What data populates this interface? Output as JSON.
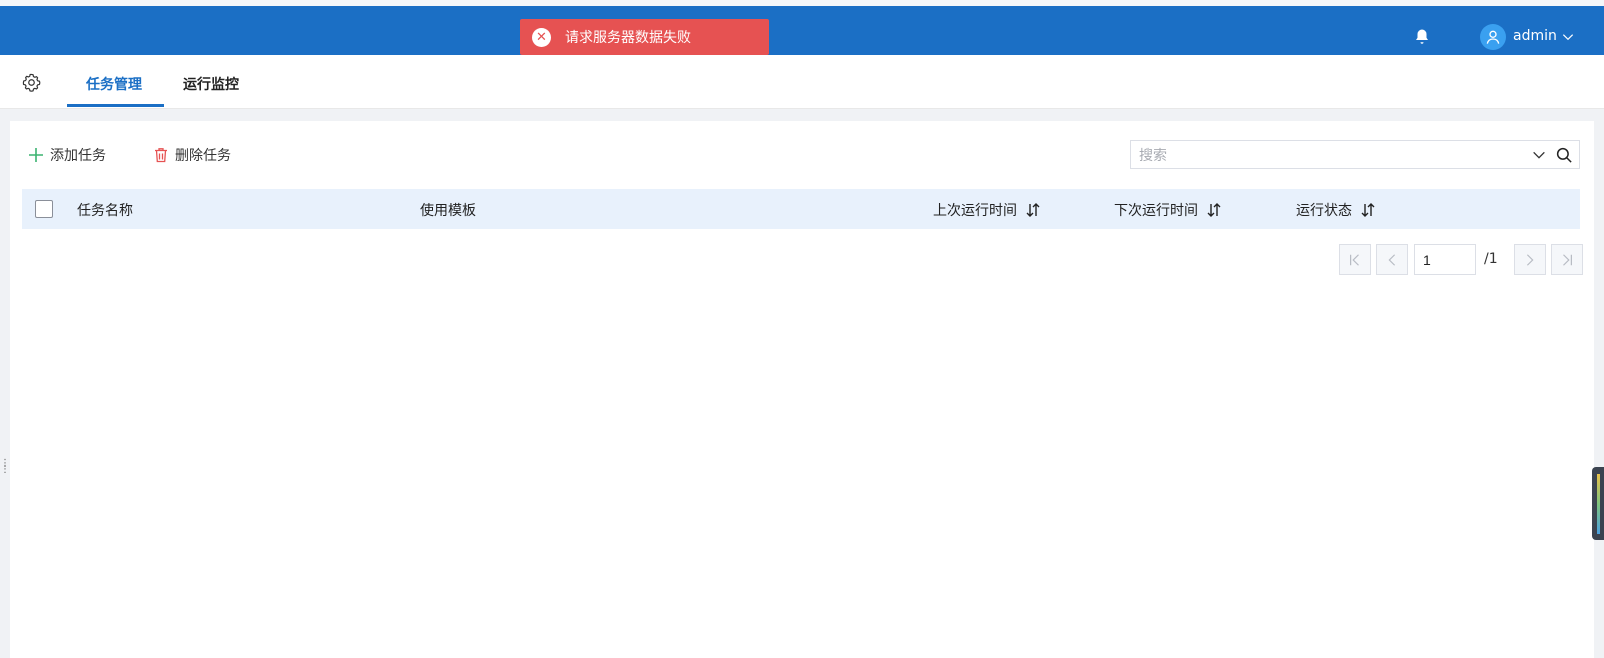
{
  "toast": {
    "message": "请求服务器数据失败",
    "icon": "close-circle-icon"
  },
  "user": {
    "name": "admin"
  },
  "tabs": [
    {
      "label": "任务管理",
      "active": true
    },
    {
      "label": "运行监控",
      "active": false
    }
  ],
  "toolbar": {
    "add_label": "添加任务",
    "delete_label": "删除任务"
  },
  "search": {
    "placeholder": "搜索",
    "value": ""
  },
  "table": {
    "columns": [
      {
        "label": "任务名称",
        "sortable": false
      },
      {
        "label": "使用模板",
        "sortable": false
      },
      {
        "label": "上次运行时间",
        "sortable": true
      },
      {
        "label": "下次运行时间",
        "sortable": true
      },
      {
        "label": "运行状态",
        "sortable": true
      }
    ],
    "rows": []
  },
  "pagination": {
    "current": "1",
    "total": "/1"
  },
  "colors": {
    "primary": "#1b6fc5",
    "error": "#e65252",
    "header_bg": "#e8f1fc",
    "add_icon": "#3cb371",
    "delete_icon": "#e65252"
  }
}
